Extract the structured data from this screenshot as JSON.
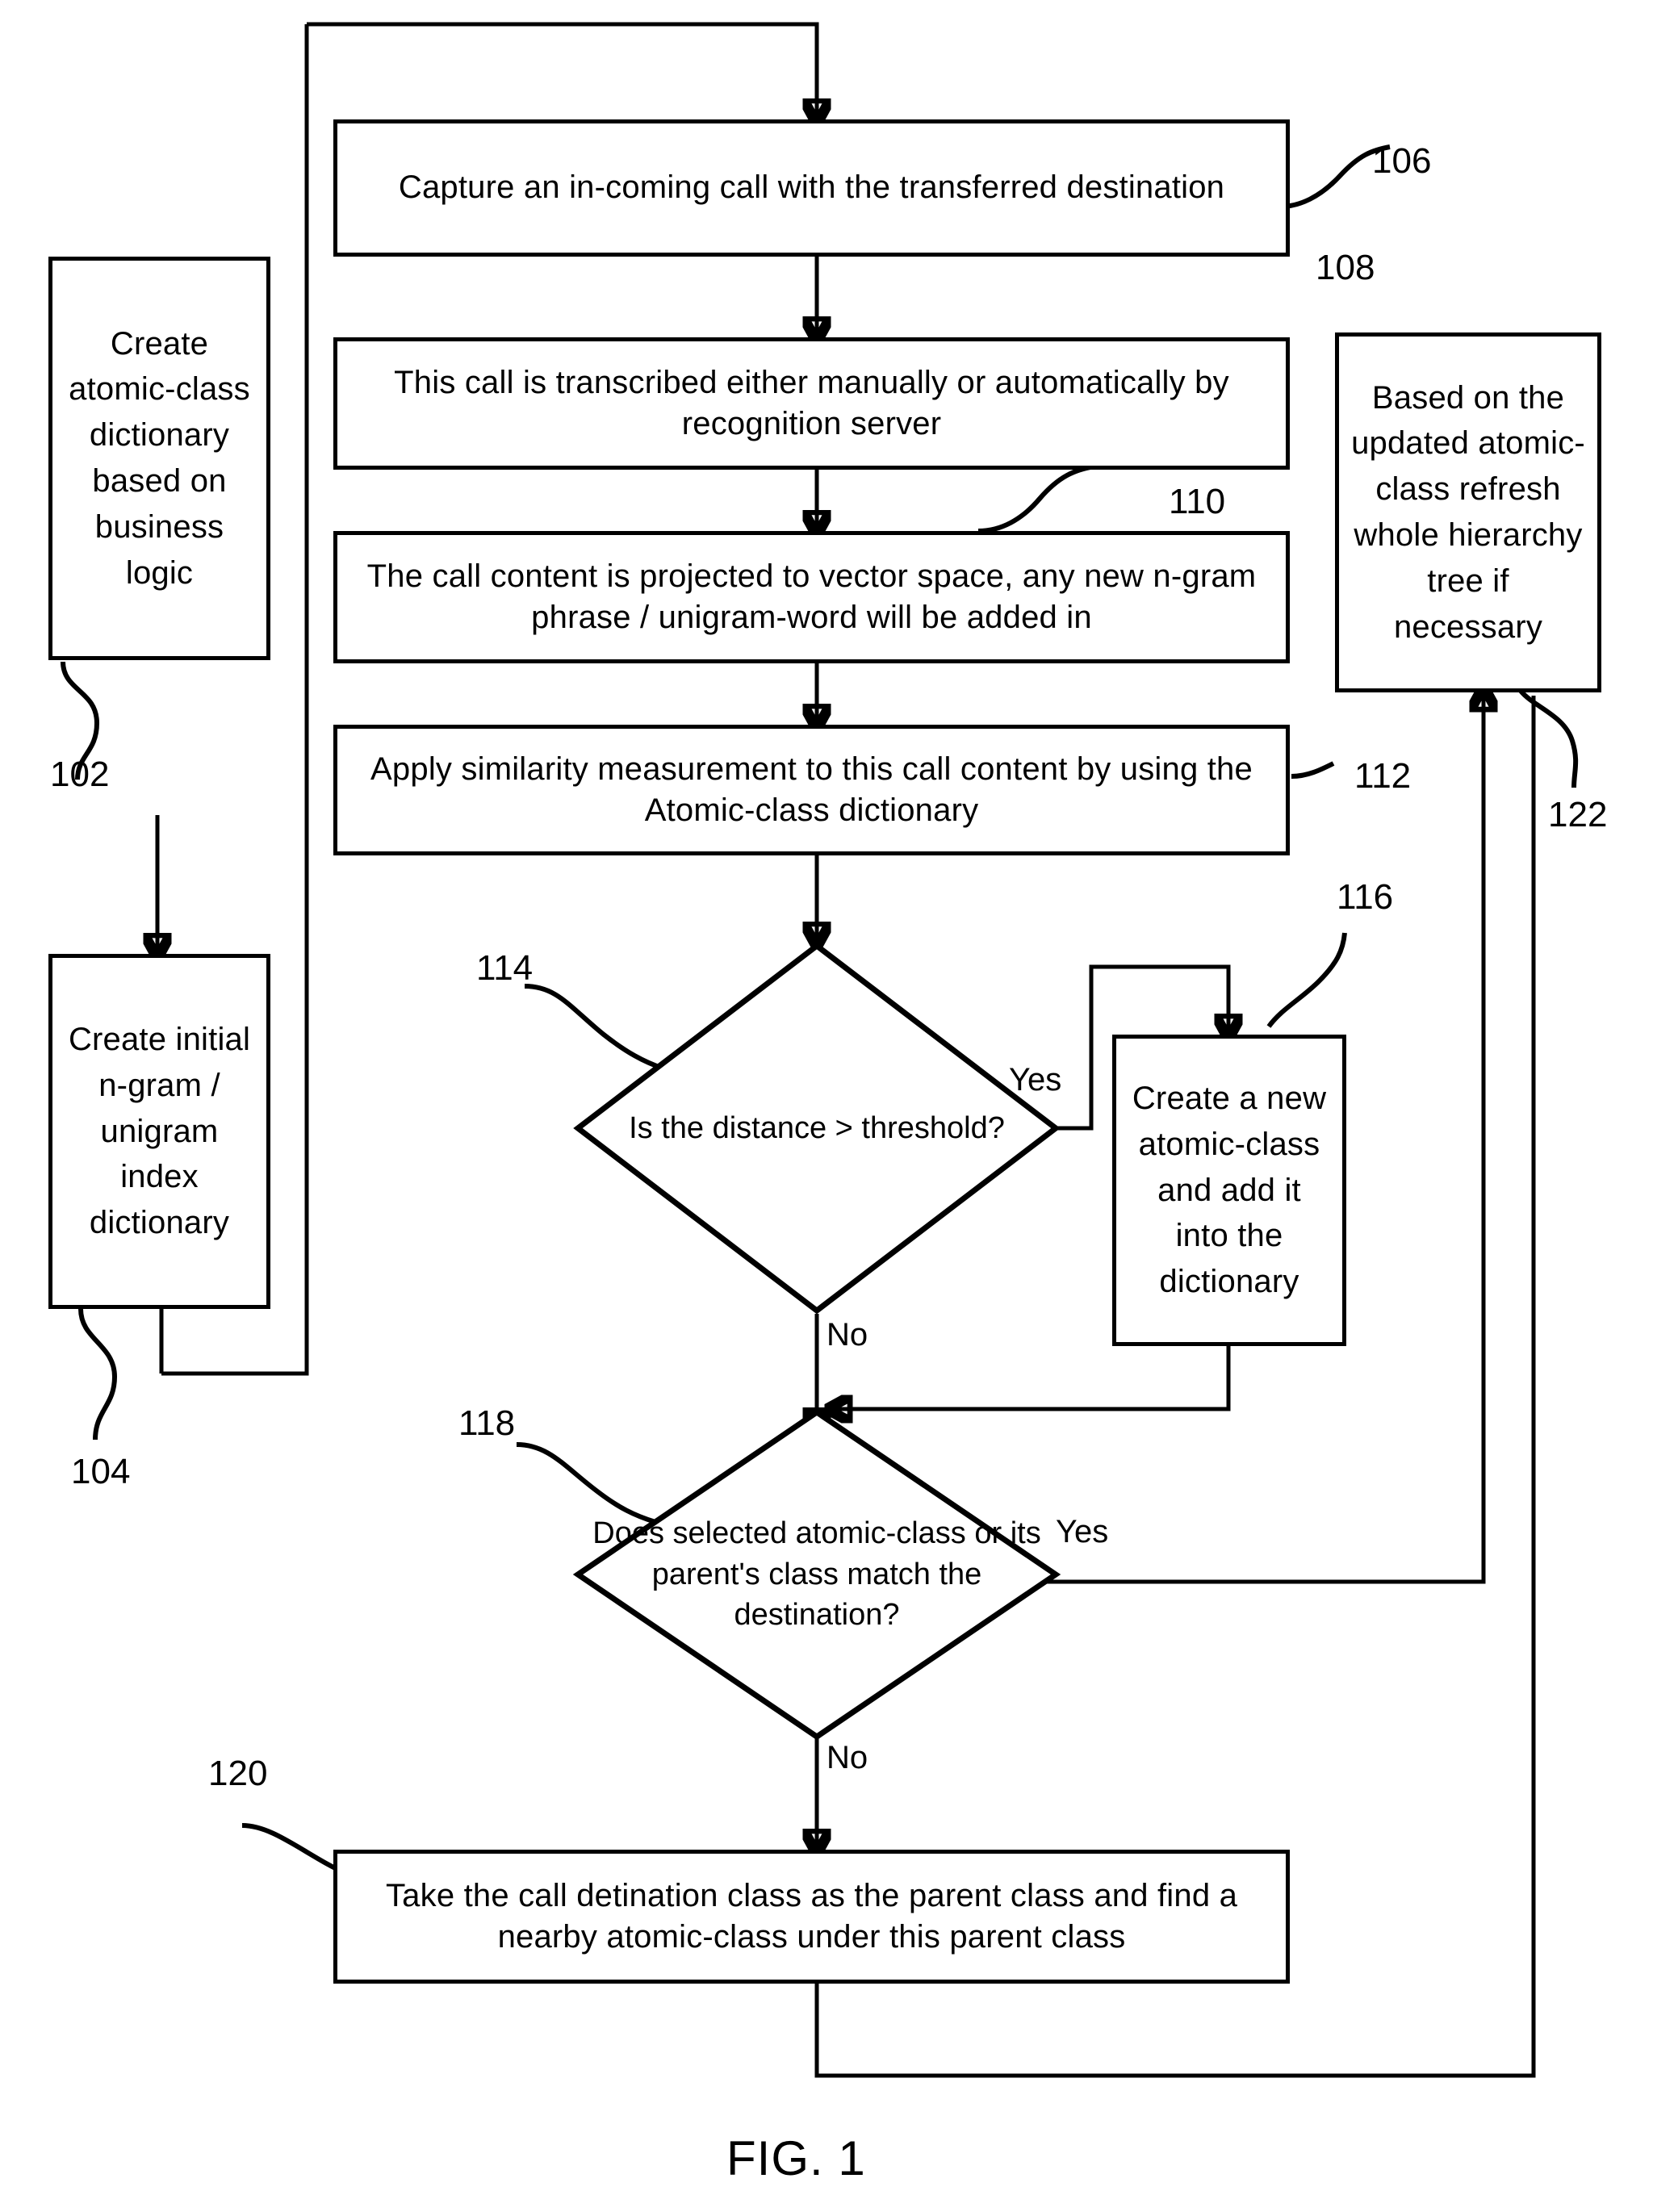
{
  "figure": {
    "caption": "FIG. 1"
  },
  "nodes": {
    "n102": {
      "ref": "102",
      "type": "process",
      "text": "Create atomic-class dictionary based on business logic"
    },
    "n104": {
      "ref": "104",
      "type": "process",
      "text": "Create initial n-gram / unigram index dictionary"
    },
    "n106": {
      "ref": "106",
      "type": "process",
      "text": "Capture an in-coming call with the transferred destination"
    },
    "n108": {
      "ref": "108",
      "type": "process",
      "text": "This call is  transcribed either manually or automatically by recognition server"
    },
    "n110": {
      "ref": "110",
      "type": "process",
      "text": "The call content is projected to vector space, any new n-gram phrase / unigram-word will be added in"
    },
    "n112": {
      "ref": "112",
      "type": "process",
      "text": "Apply similarity measurement to this call content by using the Atomic-class dictionary"
    },
    "n114": {
      "ref": "114",
      "type": "decision",
      "text": "Is the distance > threshold?"
    },
    "n116": {
      "ref": "116",
      "type": "process",
      "text": "Create a new atomic-class and add it into the dictionary"
    },
    "n118": {
      "ref": "118",
      "type": "decision",
      "text": "Does selected atomic-class  or its parent's class  match the destination?"
    },
    "n120": {
      "ref": "120",
      "type": "process",
      "text": "Take the call detination class as the parent class and find a nearby atomic-class under this parent class"
    },
    "n122": {
      "ref": "122",
      "type": "process",
      "text": "Based on the updated atomic-class refresh whole hierarchy tree if necessary"
    }
  },
  "branches": {
    "yes_114": "Yes",
    "no_114": "No",
    "yes_118": "Yes",
    "no_118": "No"
  },
  "colors": {
    "ink": "#000000",
    "paper": "#ffffff"
  }
}
